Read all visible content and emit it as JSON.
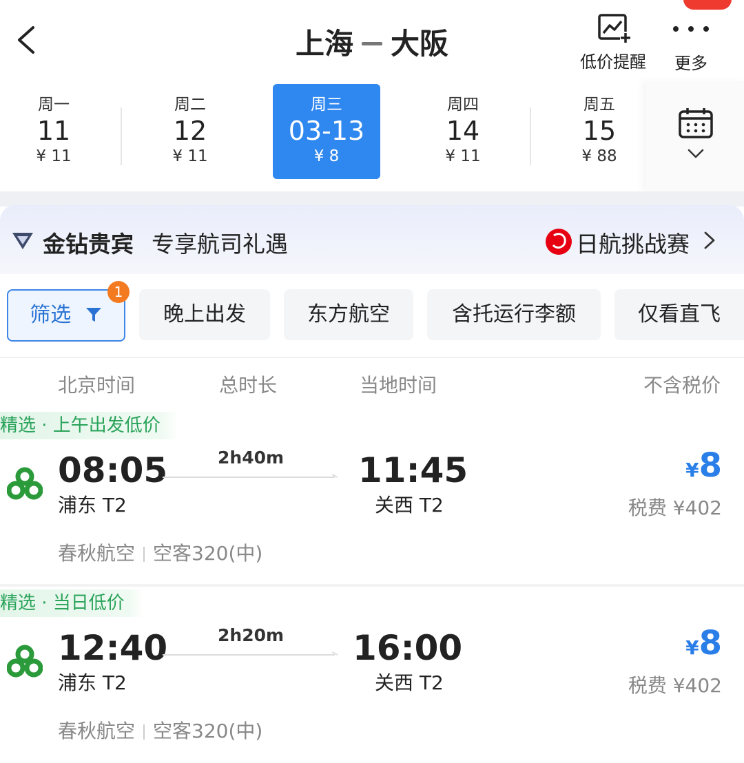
{
  "header": {
    "origin": "上海",
    "destination": "大阪",
    "price_alert_label": "低价提醒",
    "more_label": "更多"
  },
  "dates": [
    {
      "weekday": "周一",
      "date": "11",
      "price": "¥ 11",
      "selected": false
    },
    {
      "weekday": "周二",
      "date": "12",
      "price": "¥ 11",
      "selected": false
    },
    {
      "weekday": "周三",
      "date": "03-13",
      "price": "¥ 8",
      "selected": true
    },
    {
      "weekday": "周四",
      "date": "14",
      "price": "¥ 11",
      "selected": false
    },
    {
      "weekday": "周五",
      "date": "15",
      "price": "¥ 88",
      "selected": false
    }
  ],
  "member": {
    "title": "金钻贵宾",
    "subtitle": "专享航司礼遇",
    "promo": "日航挑战赛"
  },
  "filters": {
    "main_label": "筛选",
    "main_badge": "1",
    "chips": [
      "晚上出发",
      "东方航空",
      "含托运行李额",
      "仅看直飞"
    ]
  },
  "columns": {
    "beijing_time": "北京时间",
    "duration": "总时长",
    "local_time": "当地时间",
    "price_excl_tax": "不含税价"
  },
  "flights": [
    {
      "tag": "精选 · 上午出发低价",
      "dep_time": "08:05",
      "arr_time": "11:45",
      "duration": "2h40m",
      "dep_airport": "浦东 T2",
      "arr_airport": "关西 T2",
      "currency": "¥",
      "price": "8",
      "tax": "税费 ¥402",
      "airline": "春秋航空",
      "aircraft": "空客320(中)"
    },
    {
      "tag": "精选 · 当日低价",
      "dep_time": "12:40",
      "arr_time": "16:00",
      "duration": "2h20m",
      "dep_airport": "浦东 T2",
      "arr_airport": "关西 T2",
      "currency": "¥",
      "price": "8",
      "tax": "税费 ¥402",
      "airline": "春秋航空",
      "aircraft": "空客320(中)"
    }
  ],
  "colors": {
    "accent_blue": "#2f87f0",
    "price_blue": "#2a7ee8",
    "tag_green": "#2aa35a",
    "badge_orange": "#f47a20",
    "notification_red": "#ef3b2f",
    "spring_airlines_green": "#2a9a3a"
  }
}
